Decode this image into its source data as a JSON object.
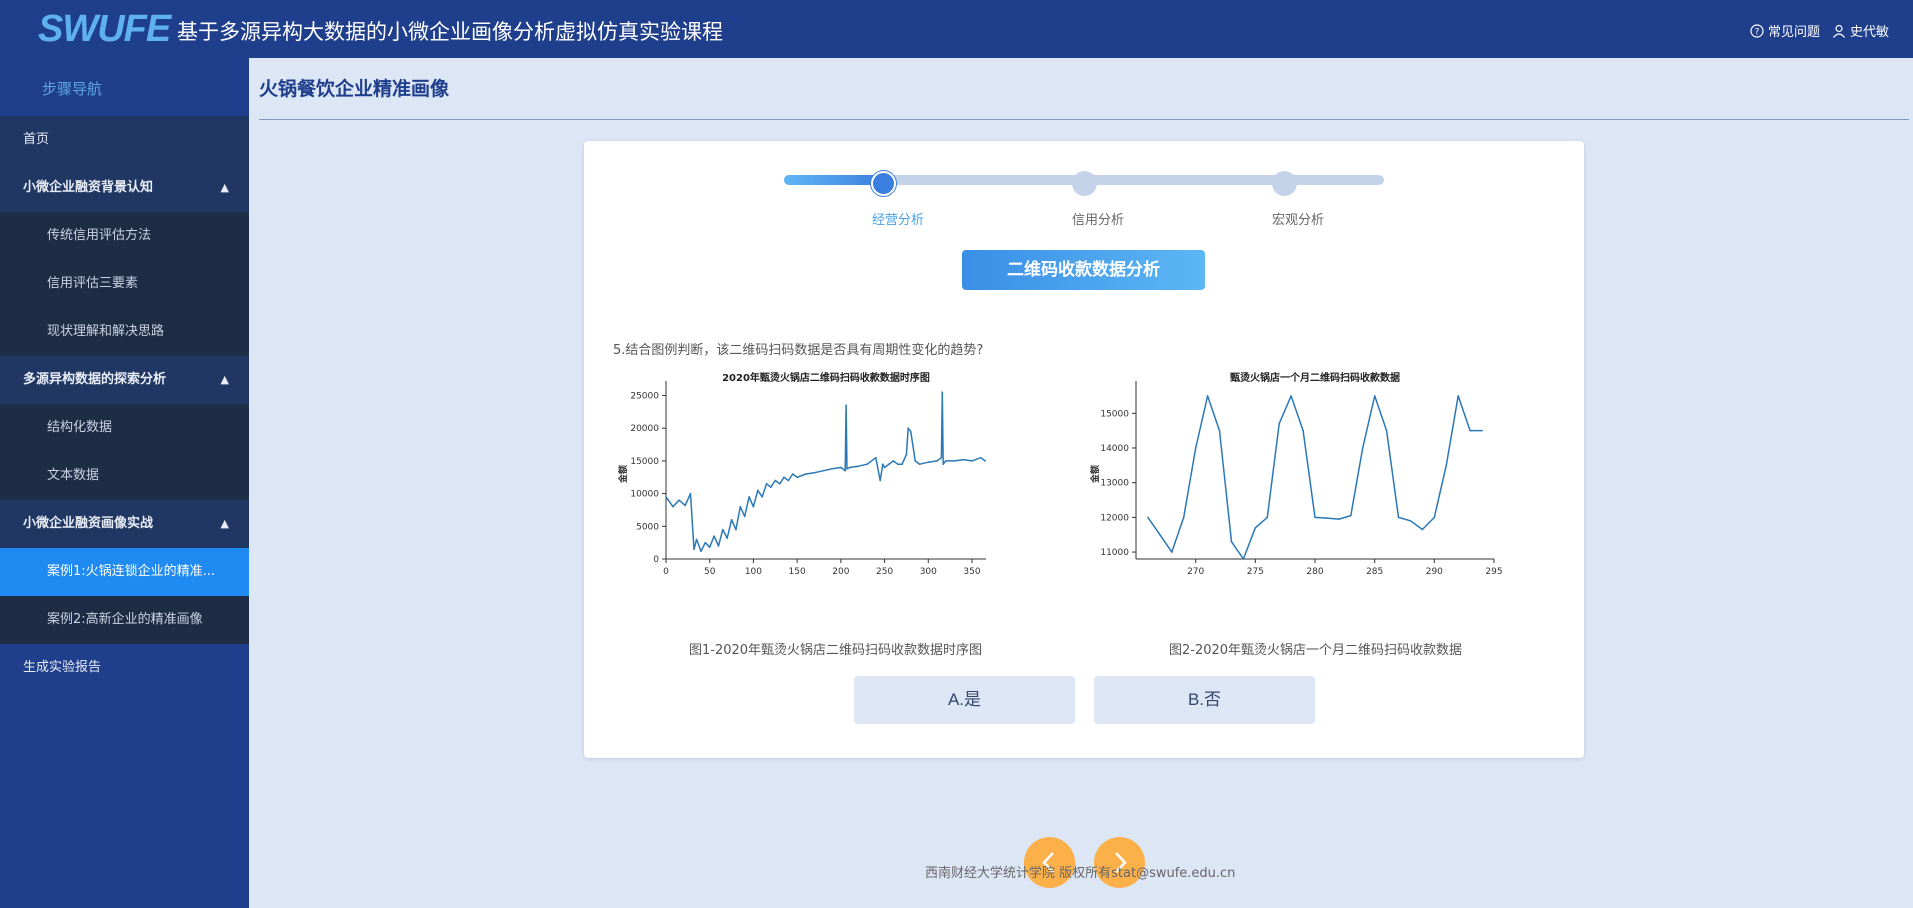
{
  "header": {
    "logo": "SWUFE",
    "title": "基于多源异构大数据的小微企业画像分析虚拟仿真实验课程",
    "faq": "常见问题",
    "user": "史代敏"
  },
  "sidebar": {
    "head": "步骤导航",
    "home": "首页",
    "groups": [
      {
        "label": "小微企业融资背景认知",
        "items": [
          "传统信用评估方法",
          "信用评估三要素",
          "现状理解和解决思路"
        ]
      },
      {
        "label": "多源异构数据的探索分析",
        "items": [
          "结构化数据",
          "文本数据"
        ]
      },
      {
        "label": "小微企业融资画像实战",
        "items": [
          "案例1:火锅连锁企业的精准...",
          "案例2:高新企业的精准画像"
        ]
      }
    ],
    "report": "生成实验报告"
  },
  "main": {
    "title": "火锅餐饮企业精准画像",
    "steps": [
      "经营分析",
      "信用分析",
      "宏观分析"
    ],
    "section_btn": "二维码收款数据分析",
    "question": "5.结合图例判断，该二维码扫码数据是否具有周期性变化的趋势?",
    "fig1_caption": "图1-2020年甄烫火锅店二维码扫码收款数据时序图",
    "fig2_caption": "图2-2020年甄烫火锅店一个月二维码扫码收款数据",
    "option_a": "A.是",
    "option_b": "B.否"
  },
  "footer": "西南财经大学统计学院 版权所有stat@swufe.edu.cn",
  "chart_data": [
    {
      "type": "line",
      "title": "2020年甄烫火锅店二维码扫码收款数据时序图",
      "ylabel": "金额",
      "xlabel": "",
      "xlim": [
        0,
        366
      ],
      "ylim": [
        0,
        26000
      ],
      "xticks": [
        0,
        50,
        100,
        150,
        200,
        250,
        300,
        350
      ],
      "yticks": [
        0,
        5000,
        10000,
        15000,
        20000,
        25000
      ],
      "x": [
        0,
        8,
        15,
        22,
        28,
        32,
        35,
        40,
        45,
        50,
        55,
        60,
        65,
        70,
        75,
        80,
        85,
        90,
        95,
        100,
        105,
        110,
        115,
        120,
        125,
        130,
        135,
        140,
        145,
        150,
        160,
        170,
        180,
        190,
        200,
        205,
        206,
        207,
        210,
        220,
        230,
        240,
        245,
        248,
        250,
        255,
        260,
        265,
        270,
        275,
        277,
        280,
        285,
        290,
        300,
        310,
        315,
        316,
        317,
        320,
        330,
        340,
        350,
        360,
        365
      ],
      "values": [
        9500,
        8000,
        9000,
        8200,
        10000,
        1500,
        3000,
        1200,
        2500,
        1800,
        3500,
        2000,
        4500,
        3200,
        6000,
        4500,
        8000,
        6500,
        9500,
        8000,
        10500,
        9500,
        11500,
        11000,
        12000,
        11500,
        12500,
        12000,
        13000,
        12500,
        13000,
        13200,
        13500,
        13800,
        14000,
        13500,
        23500,
        13800,
        14000,
        14200,
        14500,
        15500,
        12000,
        14500,
        14000,
        14500,
        15000,
        14500,
        14500,
        16000,
        20000,
        19500,
        15000,
        14500,
        14800,
        15000,
        15500,
        25500,
        14500,
        15000,
        15000,
        15200,
        15000,
        15500,
        15000
      ],
      "grid": false
    },
    {
      "type": "line",
      "title": "甄烫火锅店一个月二维码扫码收款数据",
      "ylabel": "金额",
      "xlabel": "",
      "xlim": [
        265,
        295
      ],
      "ylim": [
        10800,
        15700
      ],
      "xticks": [
        270,
        275,
        280,
        285,
        290,
        295
      ],
      "yticks": [
        11000,
        12000,
        13000,
        14000,
        15000
      ],
      "x": [
        266,
        267,
        268,
        269,
        270,
        271,
        272,
        273,
        274,
        275,
        276,
        277,
        278,
        279,
        280,
        281,
        282,
        283,
        284,
        285,
        286,
        287,
        288,
        289,
        290,
        291,
        292,
        293,
        294
      ],
      "values": [
        12000,
        11500,
        11000,
        12000,
        14000,
        15500,
        14500,
        11300,
        10800,
        11700,
        12000,
        14700,
        15500,
        14500,
        12000,
        11980,
        11950,
        12050,
        14000,
        15500,
        14500,
        12000,
        11900,
        11650,
        12000,
        13500,
        15500,
        14500,
        14500
      ],
      "grid": false
    }
  ]
}
